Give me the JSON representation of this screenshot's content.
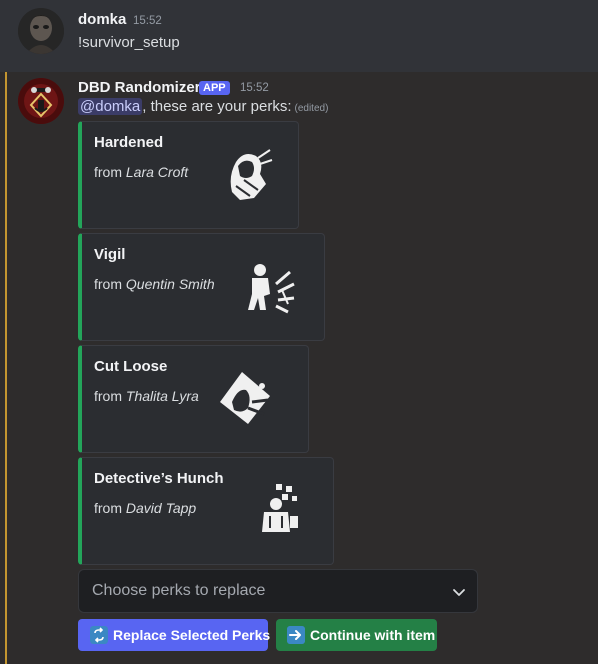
{
  "message1": {
    "username": "domka",
    "timestamp": "15:52",
    "content": "!survivor_setup",
    "avatar_icon": "user-avatar-icon"
  },
  "message2": {
    "username": "DBD Randomizer",
    "badge": "APP",
    "timestamp": "15:52",
    "mention": "@domka",
    "content": ", these are your perks:",
    "edited": "(edited)",
    "avatar_icon": "bot-avatar-icon",
    "mention_bar_color": "#c39530"
  },
  "perks": [
    {
      "title": "Hardened",
      "from_prefix": "from ",
      "from_name": "Lara Croft",
      "icon": "hardened-perk-icon"
    },
    {
      "title": "Vigil",
      "from_prefix": "from ",
      "from_name": "Quentin Smith",
      "icon": "vigil-perk-icon"
    },
    {
      "title": "Cut Loose",
      "from_prefix": "from ",
      "from_name": "Thalita Lyra",
      "icon": "cut-loose-perk-icon"
    },
    {
      "title": "Detective’s Hunch",
      "from_prefix": "from ",
      "from_name": "David Tapp",
      "icon": "detectives-hunch-perk-icon"
    }
  ],
  "select": {
    "placeholder": "Choose perks to replace",
    "icon": "chevron-down-icon"
  },
  "buttons": {
    "replace_label": "Replace Selected Perks",
    "replace_icon": "repeat-icon",
    "continue_label": "Continue with item",
    "continue_icon": "arrow-right-icon"
  },
  "colors": {
    "embed_accent": "#23a55a",
    "primary_button": "#5865f2",
    "success_button": "#248046",
    "app_badge": "#5865f2"
  }
}
